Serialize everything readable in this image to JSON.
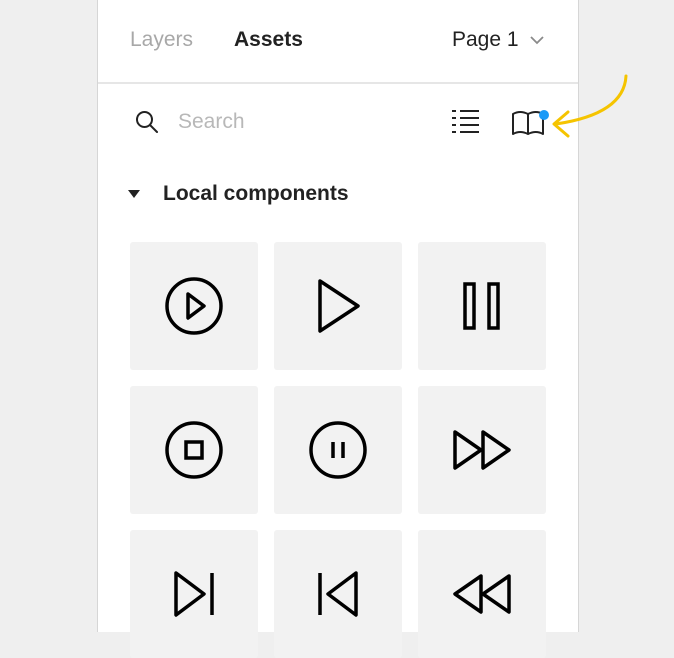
{
  "tabs": {
    "layers_label": "Layers",
    "assets_label": "Assets",
    "active": "Assets"
  },
  "page_selector": {
    "value": "Page 1",
    "icon": "chevron-down-icon"
  },
  "search": {
    "placeholder": "Search",
    "value": "",
    "icon": "search-icon"
  },
  "toolbar": {
    "list_view_icon": "list-view-icon",
    "library_icon": "team-library-icon",
    "notification_dot_color": "#1a9af7"
  },
  "section": {
    "title": "Local components",
    "expanded": true,
    "icon": "caret-down-icon"
  },
  "components": [
    {
      "icon": "play-circle-icon"
    },
    {
      "icon": "play-icon"
    },
    {
      "icon": "pause-icon"
    },
    {
      "icon": "stop-circle-icon"
    },
    {
      "icon": "pause-circle-icon"
    },
    {
      "icon": "fast-forward-icon"
    },
    {
      "icon": "skip-forward-icon"
    },
    {
      "icon": "skip-back-icon"
    },
    {
      "icon": "rewind-icon"
    }
  ],
  "colors": {
    "background": "#efefef",
    "panel": "#ffffff",
    "tile": "#f2f2f2",
    "icon_stroke": "#000000",
    "inactive_tab": "#a8a8a8",
    "annotation_arrow": "#f5c400",
    "accent_dot": "#1a9af7"
  },
  "annotation": {
    "icon": "curved-arrow-icon"
  }
}
